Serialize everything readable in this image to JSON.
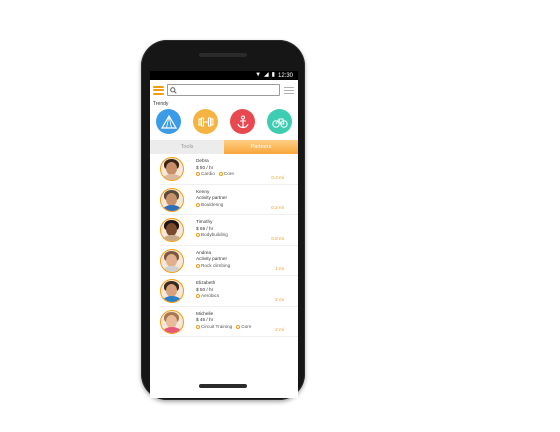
{
  "status_bar": {
    "time": "12:30",
    "signal_icon": "signal-icon",
    "wifi_icon": "wifi-icon",
    "battery_icon": "battery-icon"
  },
  "search": {
    "placeholder": "",
    "value": ""
  },
  "trendy": {
    "label": "Trendy",
    "items": [
      {
        "icon": "camping-tent-icon",
        "color": "#3b9be6"
      },
      {
        "icon": "dumbbell-icon",
        "color": "#f5b342"
      },
      {
        "icon": "anchor-icon",
        "color": "#e84850"
      },
      {
        "icon": "bicycle-icon",
        "color": "#3ecdb1"
      }
    ]
  },
  "tabs": [
    {
      "label": "Tools",
      "active": false
    },
    {
      "label": "Partners",
      "active": true
    }
  ],
  "partners": [
    {
      "name": "Debra",
      "subtitle": "$ 50 / hr",
      "tags": [
        "Cardio",
        "Core"
      ],
      "distance": "0.4 mi"
    },
    {
      "name": "Kenny",
      "subtitle": "Activity partner",
      "tags": [
        "Bouldering"
      ],
      "distance": "0.2 mi"
    },
    {
      "name": "Timothy",
      "subtitle": "$ 69 / hr",
      "tags": [
        "Bodybuilding"
      ],
      "distance": "0.8 mi"
    },
    {
      "name": "Andrea",
      "subtitle": "Activity partner",
      "tags": [
        "Rock climbing"
      ],
      "distance": "1 mi"
    },
    {
      "name": "Elizabeth",
      "subtitle": "$ 50 / hr",
      "tags": [
        "Aerobics"
      ],
      "distance": "2 mi"
    },
    {
      "name": "Michelle",
      "subtitle": "$ 46 / hr",
      "tags": [
        "Circuit Training",
        "Core"
      ],
      "distance": "2 mi"
    }
  ],
  "colors": {
    "accent": "#f39c12",
    "tab_active": "#f7a53a"
  }
}
